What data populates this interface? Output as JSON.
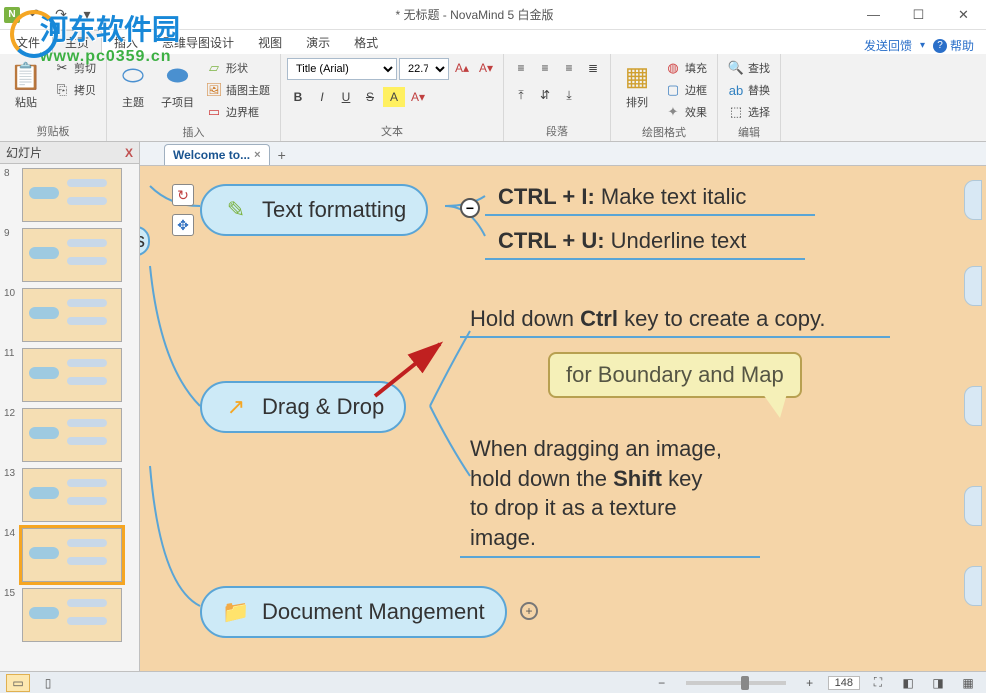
{
  "window": {
    "title": "* 无标题 - NovaMind 5 白金版"
  },
  "menu": {
    "file": "文件",
    "home": "主页",
    "insert": "插入",
    "design": "思维导图设计",
    "view": "视图",
    "present": "演示",
    "format": "格式",
    "feedback": "发送回馈",
    "help": "帮助"
  },
  "ribbon": {
    "clipboard": {
      "paste": "粘贴",
      "cut": "剪切",
      "copy": "拷贝",
      "label": "剪贴板"
    },
    "insert": {
      "topic": "主题",
      "subtopic": "子项目",
      "shape": "形状",
      "illustrated": "插图主题",
      "boundary": "边界框",
      "label": "插入"
    },
    "text": {
      "font_name": "Title (Arial)",
      "font_size": "22.75",
      "label": "文本"
    },
    "paragraph": {
      "label": "段落"
    },
    "arrange": {
      "arrange": "排列",
      "label": "绘图格式",
      "fill": "填充",
      "border": "边框",
      "effects": "效果"
    },
    "edit": {
      "find": "查找",
      "replace": "替换",
      "select": "选择",
      "label": "编辑"
    }
  },
  "slides": {
    "title": "幻灯片",
    "items": [
      8,
      9,
      10,
      11,
      12,
      13,
      14,
      15
    ],
    "selected": 14
  },
  "doc_tab": {
    "name": "Welcome to..."
  },
  "mindmap": {
    "node_text_formatting": "Text formatting",
    "ctrl_i_bold": "CTRL + I:",
    "ctrl_i_rest": " Make text italic",
    "ctrl_u_bold": "CTRL + U:",
    "ctrl_u_rest": " Underline text",
    "node_drag_drop": "Drag & Drop",
    "dd_child1_pre": "Hold down ",
    "dd_child1_bold": "Ctrl",
    "dd_child1_post": " key to create a copy.",
    "callout": "for Boundary and Map",
    "dd_child2_l1": "When dragging an image,",
    "dd_child2_l2a": "hold down the ",
    "dd_child2_l2b": "Shift",
    "dd_child2_l2c": " key",
    "dd_child2_l3": "to drop it as a texture",
    "dd_child2_l4": "image.",
    "node_doc_mgmt": "Document Mangement"
  },
  "statusbar": {
    "zoom": "148"
  },
  "watermark": {
    "line1": "河东软件园",
    "line2": "www.pc0359.cn"
  }
}
